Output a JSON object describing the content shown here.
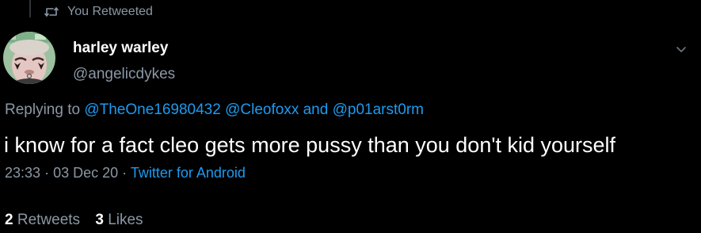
{
  "retweet_header": {
    "text": "You Retweeted",
    "icon": "retweet-icon"
  },
  "author": {
    "display_name": "harley warley",
    "handle": "@angelicdykes",
    "avatar": "avatar-image"
  },
  "menu_icon": "chevron-down-icon",
  "reply_context": {
    "prefix": "Replying to",
    "mentions": [
      "@TheOne16980432",
      "@Cleofoxx"
    ],
    "conjunction": "and",
    "last_mention": "@p01arst0rm"
  },
  "tweet": {
    "text": "i know for a fact cleo gets more pussy than you don't kid yourself"
  },
  "meta": {
    "time": "23:33",
    "separator": "·",
    "date": "03 Dec 20",
    "source": "Twitter for Android"
  },
  "stats": {
    "retweets_count": "2",
    "retweets_label": "Retweets",
    "likes_count": "3",
    "likes_label": "Likes"
  },
  "colors": {
    "background": "#000000",
    "primary_text": "#ffffff",
    "secondary_text": "#8b98a5",
    "link": "#1d9bf0"
  }
}
